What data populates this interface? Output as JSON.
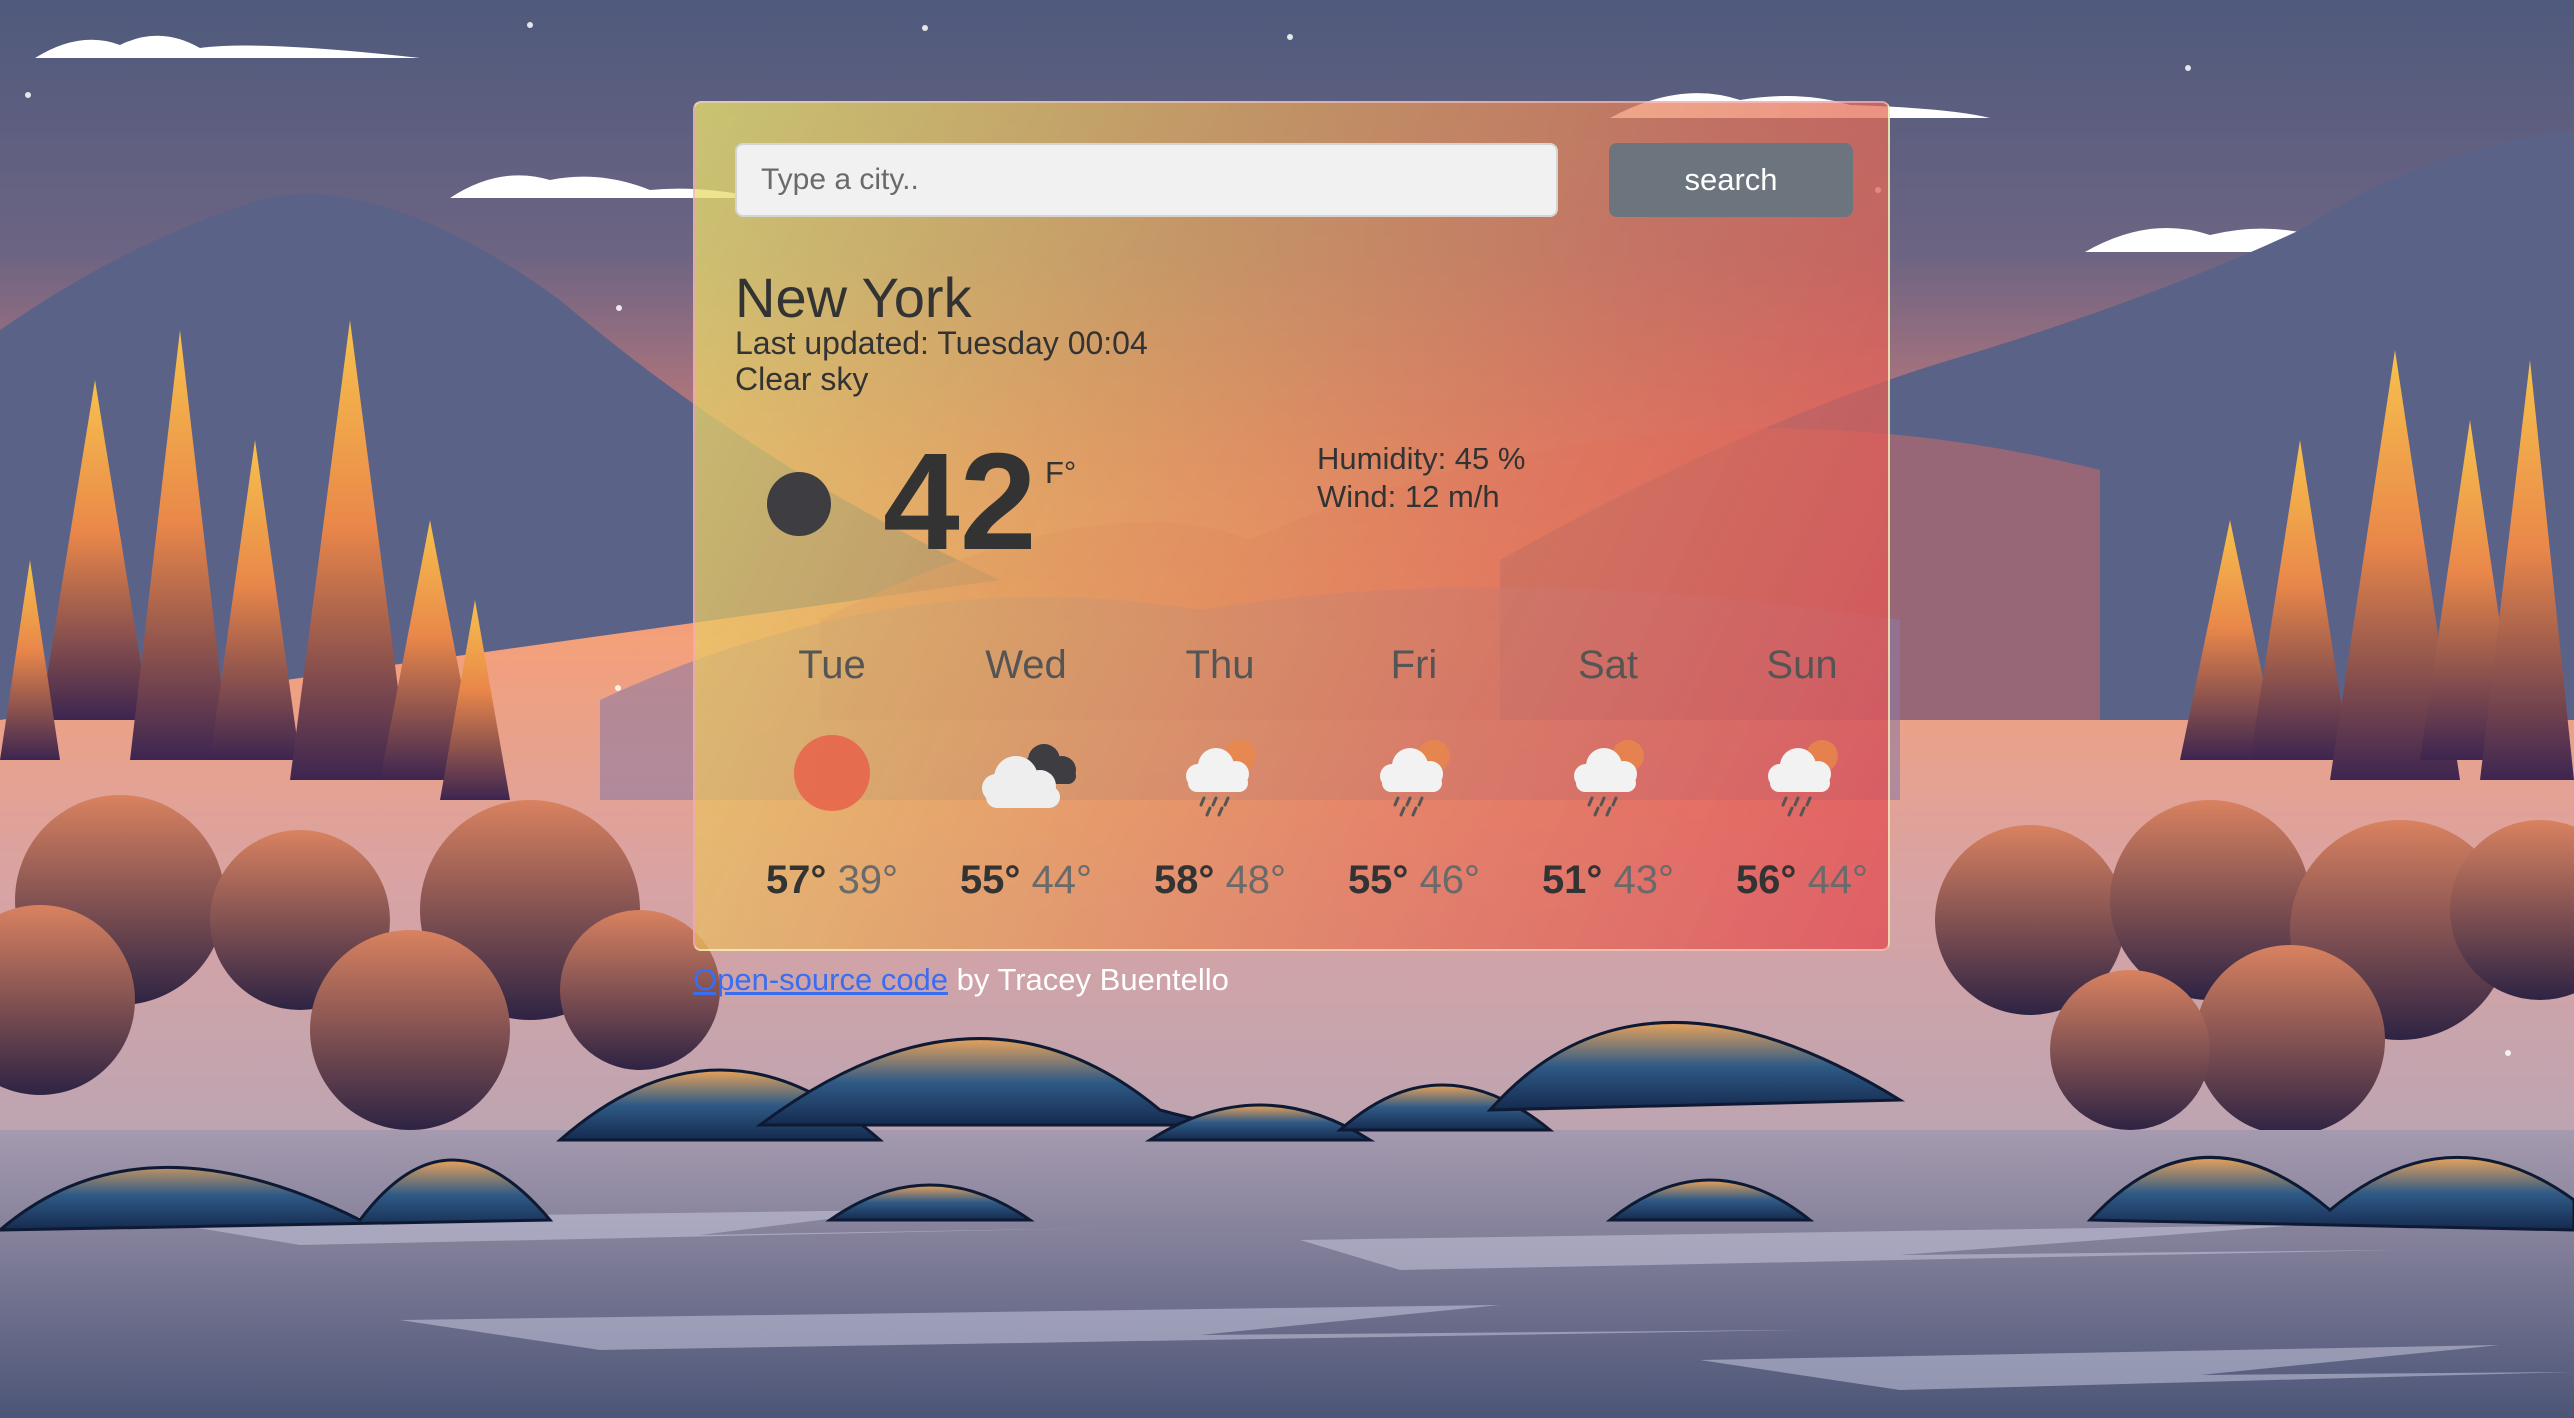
{
  "search": {
    "placeholder": "Type a city..",
    "button_label": "search"
  },
  "current": {
    "city": "New York",
    "last_updated": "Last updated: Tuesday 00:04",
    "description": "Clear sky",
    "icon": "clear-night-icon",
    "temperature": "42",
    "unit": "F°",
    "humidity": "Humidity: 45 %",
    "wind": "Wind: 12 m/h"
  },
  "forecast": [
    {
      "day": "Tue",
      "icon": "sun-icon",
      "max": "57°",
      "min": "39°"
    },
    {
      "day": "Wed",
      "icon": "cloudy-icon",
      "max": "55°",
      "min": "44°"
    },
    {
      "day": "Thu",
      "icon": "rain-icon",
      "max": "58°",
      "min": "48°"
    },
    {
      "day": "Fri",
      "icon": "rain-icon",
      "max": "55°",
      "min": "46°"
    },
    {
      "day": "Sat",
      "icon": "rain-icon",
      "max": "51°",
      "min": "43°"
    },
    {
      "day": "Sun",
      "icon": "rain-icon",
      "max": "56°",
      "min": "44°"
    }
  ],
  "footer": {
    "link_text": "Open-source code",
    "suffix": " by Tracey Buentello"
  },
  "colors": {
    "button": "#6c757d",
    "sun": "#e8614a",
    "link": "#3a6df0",
    "card_gradient_start": "#e8e06e",
    "card_gradient_end": "#e24c54"
  }
}
